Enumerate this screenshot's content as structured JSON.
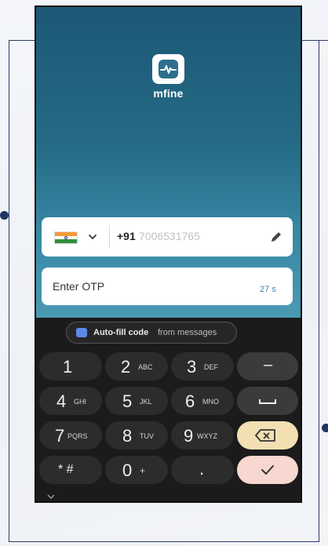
{
  "app": {
    "name": "mfine"
  },
  "phone_entry": {
    "country_code": "+91",
    "number": "7006531765"
  },
  "otp": {
    "placeholder": "Enter OTP",
    "timer": "27 s"
  },
  "autofill": {
    "primary": "Auto-fill code",
    "secondary": "from messages"
  },
  "keypad": {
    "row1": [
      {
        "digit": "1",
        "letters": ""
      },
      {
        "digit": "2",
        "letters": "ABC"
      },
      {
        "digit": "3",
        "letters": "DEF"
      },
      {
        "symbol": "–"
      }
    ],
    "row2": [
      {
        "digit": "4",
        "letters": "GHI"
      },
      {
        "digit": "5",
        "letters": "JKL"
      },
      {
        "digit": "6",
        "letters": "MNO"
      }
    ],
    "row3": [
      {
        "digit": "7",
        "letters": "PQRS"
      },
      {
        "digit": "8",
        "letters": "TUV"
      },
      {
        "digit": "9",
        "letters": "WXYZ"
      }
    ],
    "row4": [
      {
        "digit": "* #",
        "letters": ""
      },
      {
        "digit": "0",
        "letters": "+"
      },
      {
        "digit": ".",
        "letters": ""
      }
    ]
  },
  "colors": {
    "brand_teal": "#246b86",
    "keyboard_bg": "#1b1b1b",
    "key_bg": "#2c2c2c",
    "delete_key": "#f2e0b3",
    "enter_key": "#f7d7cf",
    "timer_blue": "#3d83b0",
    "frame_navy": "#2a3d68"
  },
  "icons": [
    "mfine-logo-icon",
    "india-flag-icon",
    "chevron-down-icon",
    "pencil-icon",
    "chat-bubble-icon",
    "space-icon",
    "backspace-icon",
    "check-icon"
  ]
}
